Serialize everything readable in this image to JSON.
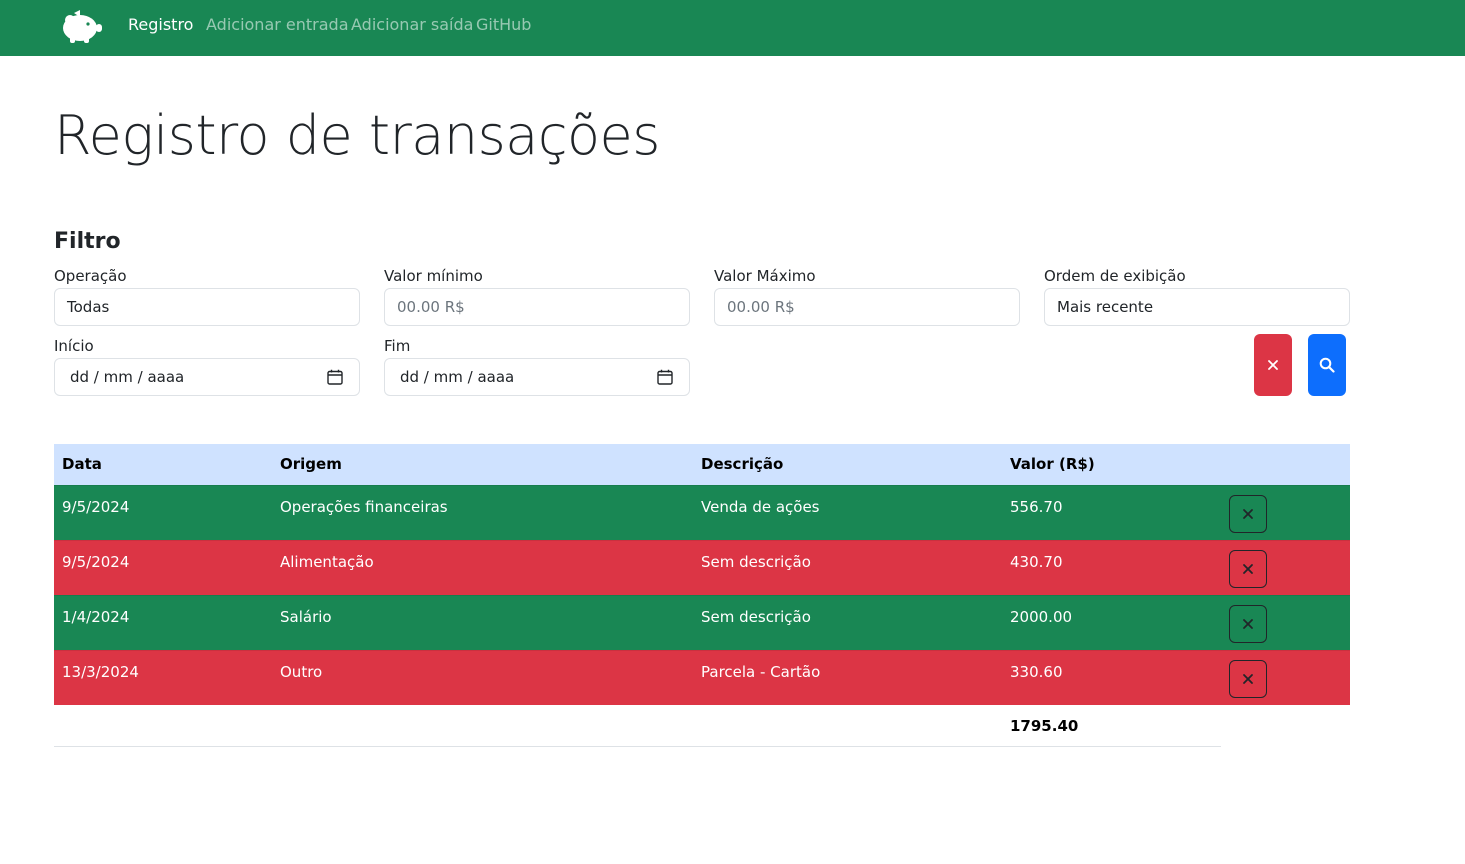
{
  "nav": {
    "logo": "piggy-bank",
    "links": [
      {
        "label": "Registro",
        "active": true
      },
      {
        "label": "Adicionar entrada",
        "active": false
      },
      {
        "label": "Adicionar saída",
        "active": false
      },
      {
        "label": "GitHub",
        "active": false
      }
    ]
  },
  "page": {
    "title": "Registro de transações"
  },
  "filter": {
    "title": "Filtro",
    "operation": {
      "label": "Operação",
      "value": "Todas"
    },
    "min_value": {
      "label": "Valor mínimo",
      "placeholder": "00.00 R$"
    },
    "max_value": {
      "label": "Valor Máximo",
      "placeholder": "00.00 R$"
    },
    "order": {
      "label": "Ordem de exibição",
      "value": "Mais recente"
    },
    "start": {
      "label": "Início",
      "placeholder": "dd / mm / aaaa"
    },
    "end": {
      "label": "Fim",
      "placeholder": "dd / mm / aaaa"
    },
    "clear_icon": "close-icon",
    "search_icon": "search-icon"
  },
  "table": {
    "headers": [
      "Data",
      "Origem",
      "Descrição",
      "Valor (R$)"
    ],
    "rows": [
      {
        "date": "9/5/2024",
        "origin": "Operações financeiras",
        "description": "Venda de ações",
        "value": "556.70",
        "type": "income"
      },
      {
        "date": "9/5/2024",
        "origin": "Alimentação",
        "description": "Sem descrição",
        "value": "430.70",
        "type": "expense"
      },
      {
        "date": "1/4/2024",
        "origin": "Salário",
        "description": "Sem descrição",
        "value": "2000.00",
        "type": "income"
      },
      {
        "date": "13/3/2024",
        "origin": "Outro",
        "description": "Parcela - Cartão",
        "value": "330.60",
        "type": "expense"
      }
    ],
    "total": "1795.40"
  },
  "colors": {
    "income": "#198754",
    "expense": "#dc3545",
    "header": "#cfe2ff",
    "search": "#0d6efd"
  }
}
